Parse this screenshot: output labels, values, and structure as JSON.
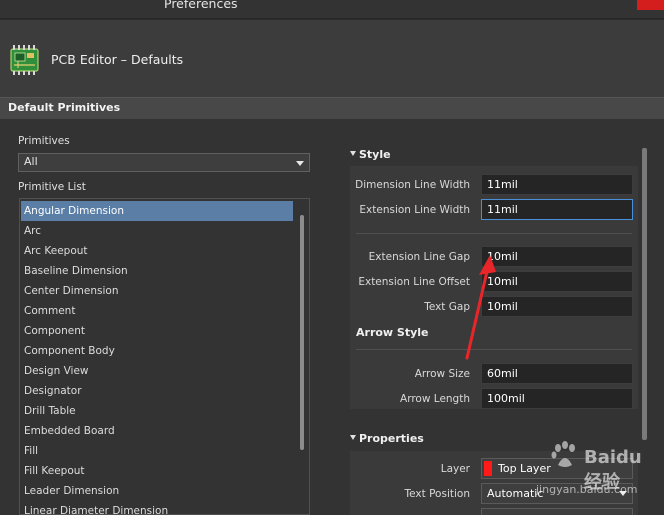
{
  "window": {
    "title": "Preferences"
  },
  "header": {
    "title": "PCB Editor – Defaults",
    "icon": "pcb-board-icon"
  },
  "section": {
    "title": "Default Primitives"
  },
  "left": {
    "primitives_label": "Primitives",
    "primitives_value": "All",
    "list_label": "Primitive List",
    "items": [
      "Angular Dimension",
      "Arc",
      "Arc Keepout",
      "Baseline Dimension",
      "Center Dimension",
      "Comment",
      "Component",
      "Component Body",
      "Design View",
      "Designator",
      "Drill Table",
      "Embedded Board",
      "Fill",
      "Fill Keepout",
      "Leader Dimension",
      "Linear Diameter Dimension"
    ],
    "selected_index": 0
  },
  "style": {
    "title": "Style",
    "dimension_line_width_label": "Dimension Line Width",
    "dimension_line_width": "11mil",
    "extension_line_width_label": "Extension Line Width",
    "extension_line_width": "11mil",
    "extension_line_gap_label": "Extension Line Gap",
    "extension_line_gap": "10mil",
    "extension_line_offset_label": "Extension Line Offset",
    "extension_line_offset": "10mil",
    "text_gap_label": "Text Gap",
    "text_gap": "10mil",
    "arrow_style_title": "Arrow Style",
    "arrow_size_label": "Arrow Size",
    "arrow_size": "60mil",
    "arrow_length_label": "Arrow Length",
    "arrow_length": "100mil"
  },
  "properties": {
    "title": "Properties",
    "layer_label": "Layer",
    "layer_value": "Top Layer",
    "text_position_label": "Text Position",
    "text_position_value": "Automatic"
  },
  "watermark": {
    "text": "Baidu经验",
    "sub": "jingyan.baidu.com"
  },
  "colors": {
    "accent": "#4a90d9",
    "selection": "#5a7ea6",
    "annotation": "#e8262a",
    "layer": "#ff1a1a"
  }
}
